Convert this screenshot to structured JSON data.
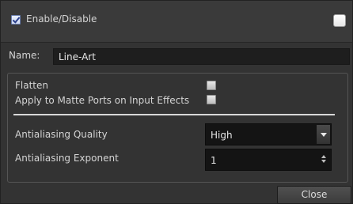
{
  "header": {
    "enable_label": "Enable/Disable",
    "enable_checked": true,
    "right_checkbox_checked": false
  },
  "name": {
    "label": "Name:",
    "value": "Line-Art"
  },
  "options": {
    "flatten_label": "Flatten",
    "flatten_checked": false,
    "matte_ports_label": "Apply to Matte Ports on Input Effects",
    "matte_ports_checked": false
  },
  "antialiasing": {
    "quality_label": "Antialiasing Quality",
    "quality_value": "High",
    "exponent_label": "Antialiasing Exponent",
    "exponent_value": "1"
  },
  "footer": {
    "close_label": "Close"
  }
}
